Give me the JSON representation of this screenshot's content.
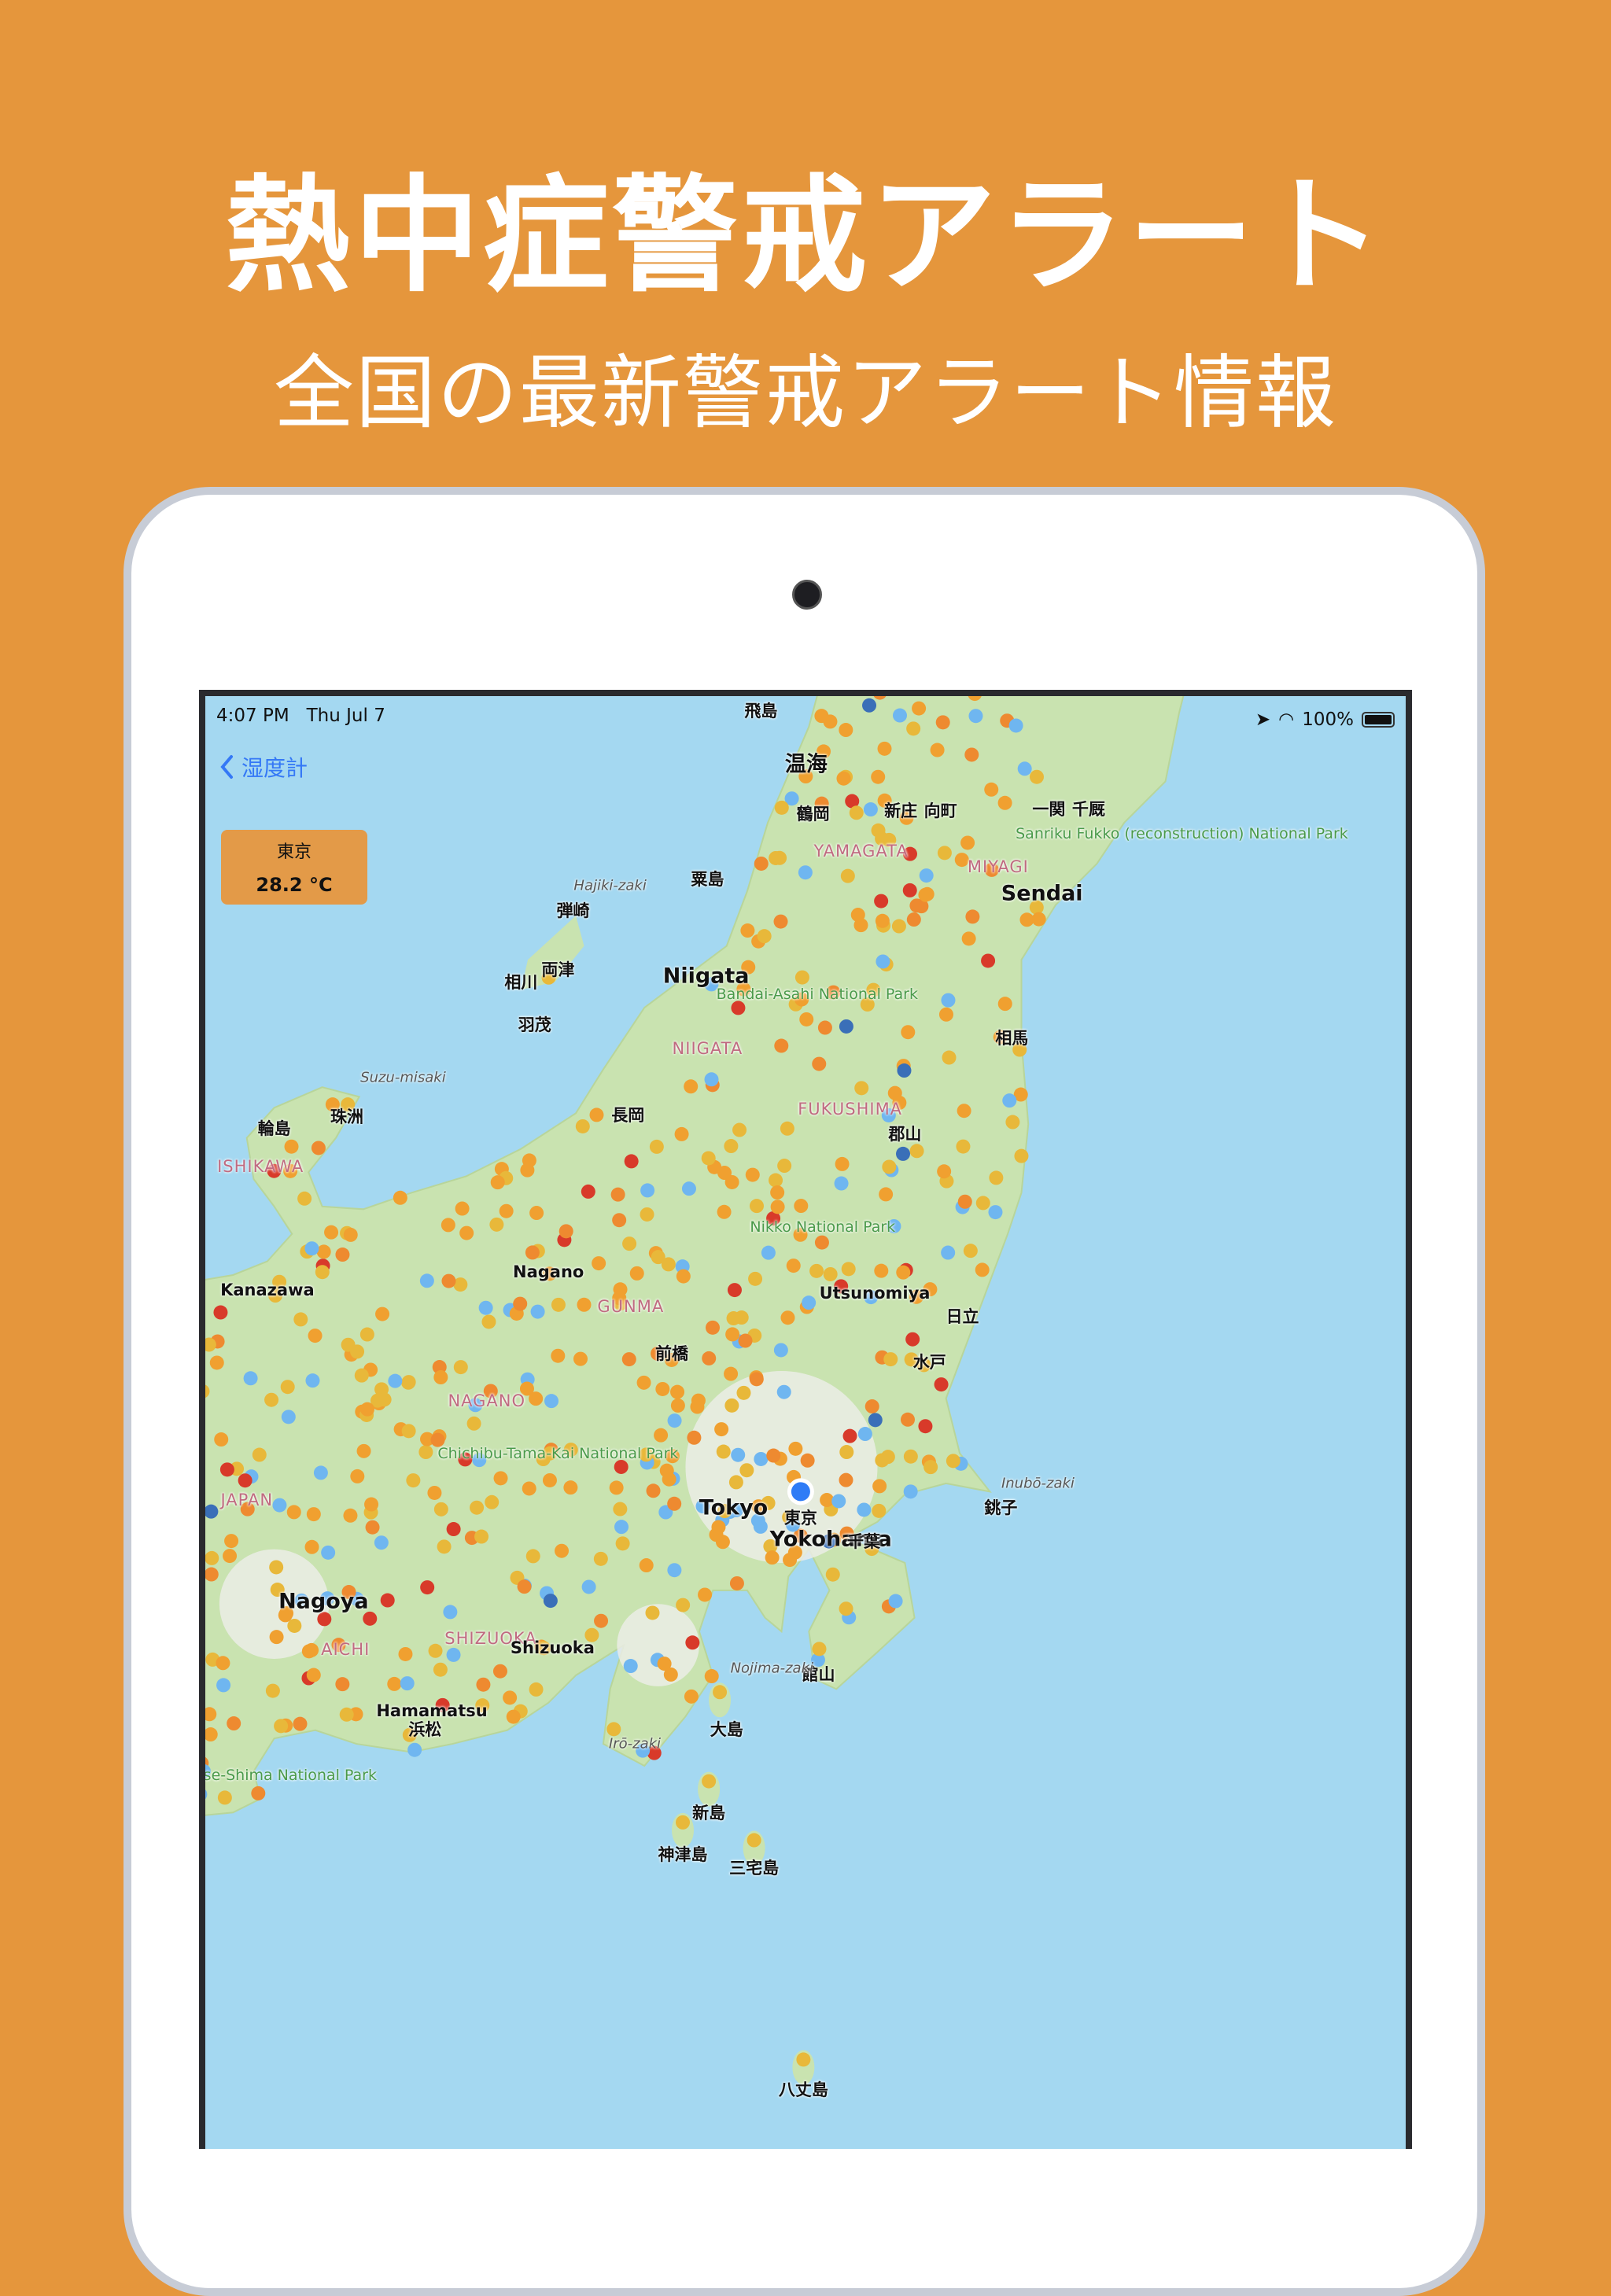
{
  "header": {
    "title": "熱中症警戒アラート",
    "subtitle": "全国の最新警戒アラート情報"
  },
  "status_bar": {
    "time": "4:07 PM",
    "date": "Thu Jul 7",
    "battery": "100%",
    "icons": [
      "location-arrow-icon",
      "wifi-icon",
      "battery-icon"
    ]
  },
  "nav": {
    "back_label": "湿度計",
    "back_icon": "chevron-left-icon"
  },
  "callout": {
    "place": "東京",
    "temperature": "28.2 °C"
  },
  "colors": {
    "background": "#e5963c",
    "sea": "#a4d8f1",
    "land": "#c9e3b0",
    "marker_palette": [
      "#f0a030",
      "#e8b83a",
      "#ee8a30",
      "#6fb6f0",
      "#d83a2a",
      "#3a6fb8"
    ],
    "current_location": "#2f7cf6"
  },
  "map_labels": [
    {
      "text": "飛島",
      "kind": "city"
    },
    {
      "text": "温海",
      "kind": "big"
    },
    {
      "text": "鶴岡",
      "kind": "city"
    },
    {
      "text": "新庄",
      "kind": "city"
    },
    {
      "text": "向町",
      "kind": "city"
    },
    {
      "text": "一関",
      "kind": "city"
    },
    {
      "text": "千厩",
      "kind": "city"
    },
    {
      "text": "Sanriku Fukko (reconstruction) National Park",
      "kind": "park"
    },
    {
      "text": "YAMAGATA",
      "kind": "pref"
    },
    {
      "text": "MIYAGI",
      "kind": "pref"
    },
    {
      "text": "Sendai",
      "kind": "big"
    },
    {
      "text": "粟島",
      "kind": "city"
    },
    {
      "text": "弾崎",
      "kind": "city"
    },
    {
      "text": "両津",
      "kind": "city"
    },
    {
      "text": "相川",
      "kind": "city"
    },
    {
      "text": "羽茂",
      "kind": "city"
    },
    {
      "text": "Hajiki-zaki",
      "kind": "cape"
    },
    {
      "text": "Niigata",
      "kind": "big"
    },
    {
      "text": "NIIGATA",
      "kind": "pref"
    },
    {
      "text": "長岡",
      "kind": "city"
    },
    {
      "text": "Suzu-misaki",
      "kind": "cape"
    },
    {
      "text": "珠洲",
      "kind": "city"
    },
    {
      "text": "輪島",
      "kind": "city"
    },
    {
      "text": "ISHIKAWA",
      "kind": "pref"
    },
    {
      "text": "Kanazawa",
      "kind": "city"
    },
    {
      "text": "Nagano",
      "kind": "city"
    },
    {
      "text": "FUKUSHIMA",
      "kind": "pref"
    },
    {
      "text": "郡山",
      "kind": "city"
    },
    {
      "text": "Utsunomiya",
      "kind": "city"
    },
    {
      "text": "GUNMA",
      "kind": "pref"
    },
    {
      "text": "前橋",
      "kind": "city"
    },
    {
      "text": "NAGANO",
      "kind": "pref"
    },
    {
      "text": "Tokyo",
      "kind": "big"
    },
    {
      "text": "東京",
      "kind": "city"
    },
    {
      "text": "Yokohama",
      "kind": "big"
    },
    {
      "text": "千葉",
      "kind": "city"
    },
    {
      "text": "Nagoya",
      "kind": "big"
    },
    {
      "text": "AICHI",
      "kind": "pref"
    },
    {
      "text": "SHIZUOKA",
      "kind": "pref"
    },
    {
      "text": "Shizuoka",
      "kind": "city"
    },
    {
      "text": "Hamamatsu",
      "kind": "city"
    },
    {
      "text": "浜松",
      "kind": "city"
    },
    {
      "text": "Inubō-zaki",
      "kind": "cape"
    },
    {
      "text": "銚子",
      "kind": "city"
    },
    {
      "text": "水戸",
      "kind": "city"
    },
    {
      "text": "日立",
      "kind": "city"
    },
    {
      "text": "館山",
      "kind": "city"
    },
    {
      "text": "Nojima-zaki",
      "kind": "cape"
    },
    {
      "text": "大島",
      "kind": "city"
    },
    {
      "text": "新島",
      "kind": "city"
    },
    {
      "text": "神津島",
      "kind": "city"
    },
    {
      "text": "三宅島",
      "kind": "city"
    },
    {
      "text": "八丈島",
      "kind": "city"
    },
    {
      "text": "Irō-zaki",
      "kind": "cape"
    },
    {
      "text": "JAPAN",
      "kind": "pref"
    },
    {
      "text": "Chichibu-Tama-Kai National Park",
      "kind": "park"
    },
    {
      "text": "Nikko National Park",
      "kind": "park"
    },
    {
      "text": "Bandai-Asahi National Park",
      "kind": "park"
    },
    {
      "text": "Ise-Shima National Park",
      "kind": "park"
    },
    {
      "text": "相馬",
      "kind": "city"
    }
  ]
}
